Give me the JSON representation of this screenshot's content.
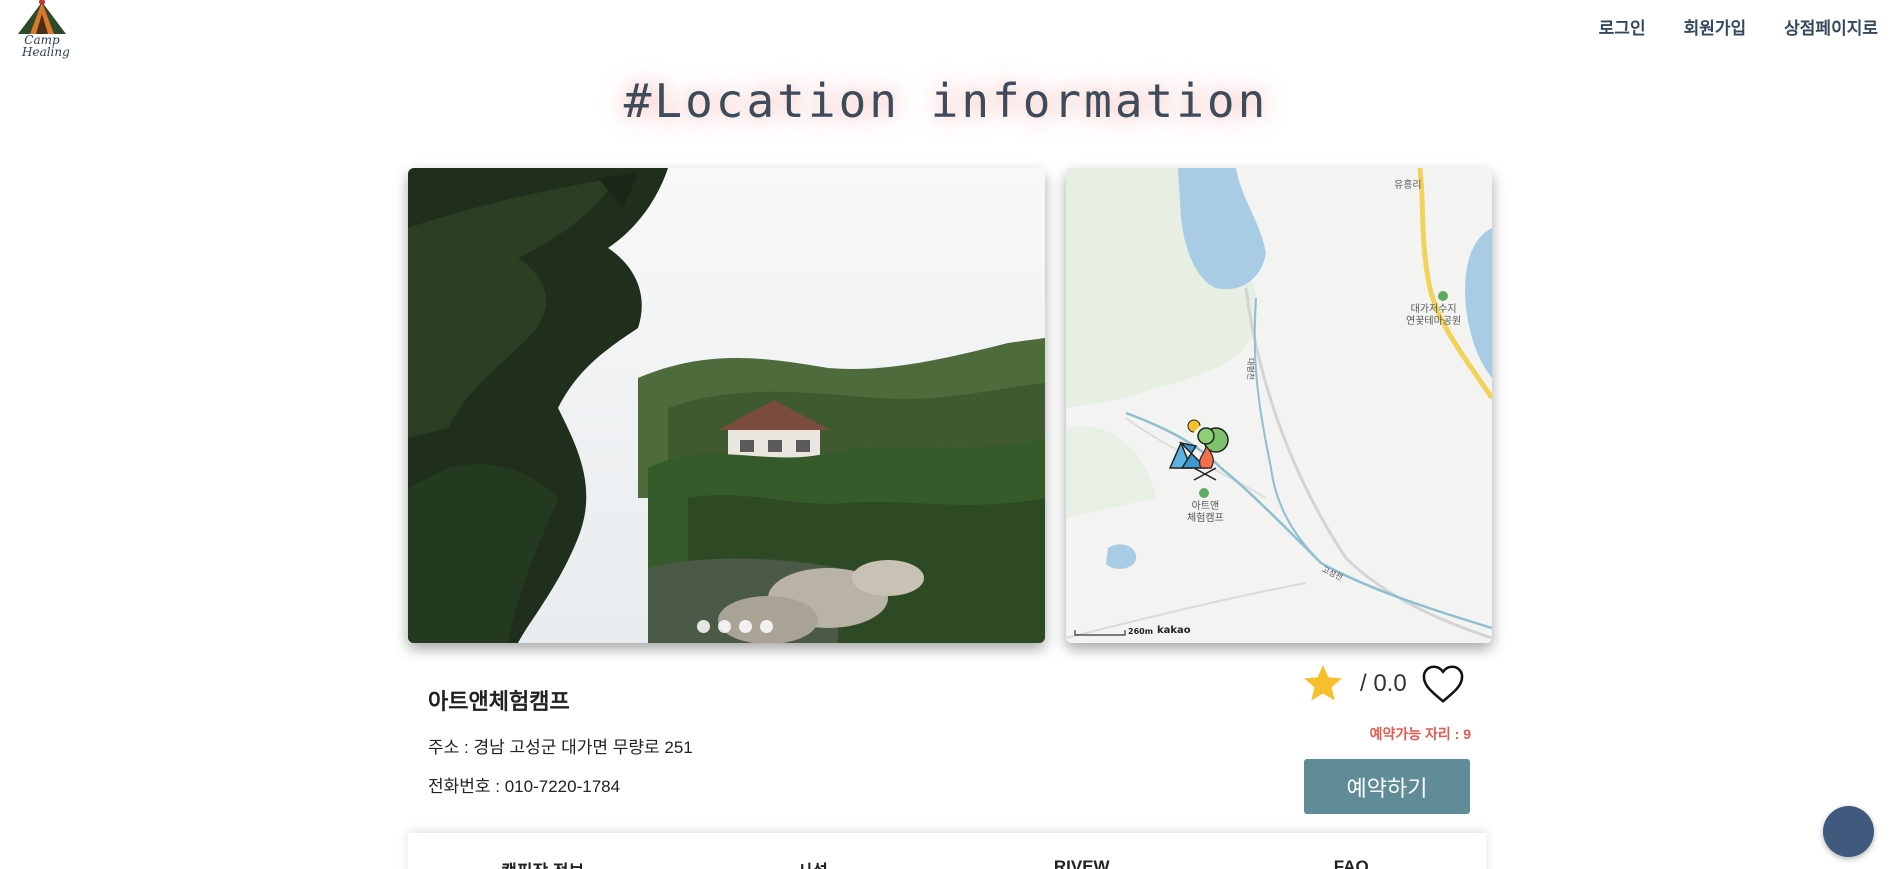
{
  "logo": {
    "text_line1": "Camp",
    "text_line2": "Healing"
  },
  "nav": {
    "login": "로그인",
    "signup": "회원가입",
    "shop": "상점페이지로"
  },
  "page_title": "#Location information",
  "carousel": {
    "slide_count": 4,
    "active_index": 1
  },
  "map": {
    "labels": {
      "village": "유흥리",
      "park_line1": "대가저수지",
      "park_line2": "연꽃테마공원",
      "camp_line1": "아트앤",
      "camp_line2": "체험캠프",
      "stream1": "대평천",
      "stream2": "고성천"
    },
    "scale_text": "260m",
    "provider": "kakao"
  },
  "camp": {
    "name": "아트앤체험캠프",
    "address": "주소 : 경남 고성군 대가면 무량로 251",
    "phone": "전화번호 : 010-7220-1784"
  },
  "rating": {
    "text": "/ 0.0",
    "star_color": "#f5c02c"
  },
  "availability": "예약가능 자리 : 9",
  "reserve_button": "예약하기",
  "tabs": [
    "캠핑장 정보",
    "시설",
    "RIVEW",
    "FAQ"
  ],
  "colors": {
    "accent": "#5f8c97",
    "alert": "#e05a4e",
    "chat": "#3f5a7c"
  }
}
